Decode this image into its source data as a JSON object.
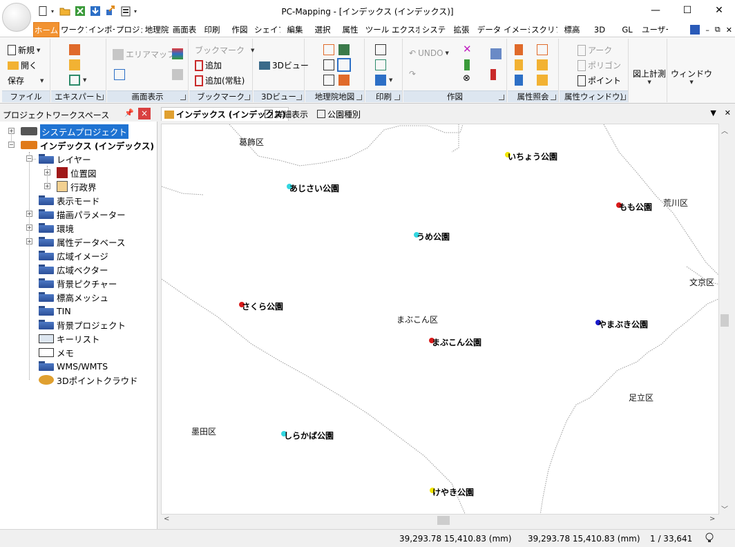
{
  "window": {
    "title": "PC-Mapping - [インデックス (インデックス)]",
    "controls": {
      "minimize": "—",
      "maximize": "☐",
      "close": "✕"
    }
  },
  "qat": {
    "items": [
      "new-doc-icon",
      "open-folder-icon",
      "excel-icon",
      "download-icon",
      "export-icon",
      "clipboard-icon"
    ]
  },
  "ribbon_tabs": [
    "ホーム",
    "ワークフ",
    "インポー",
    "プロジェ",
    "地理院",
    "画面表",
    "印刷",
    "作図",
    "シェイフ",
    "編集",
    "選択",
    "属性",
    "ツール",
    "エクスポ",
    "システ",
    "拡張",
    "データ",
    "イメージ",
    "スクリフ",
    "標高",
    "3D",
    "GL",
    "ユーザー"
  ],
  "ribbon_tab_controls": {
    "minimize": "–",
    "restore": "⧉",
    "close": "✕"
  },
  "ribbon": {
    "file": {
      "label": "ファイル",
      "new": "新規",
      "open": "開く",
      "save": "保存"
    },
    "expert": {
      "label": "エキスパート"
    },
    "view": {
      "label": "画面表示",
      "area_map": "エリアマップ"
    },
    "bookmark": {
      "label": "ブックマーク",
      "bookmark": "ブックマーク",
      "add": "追加",
      "add_resident": "追加(常駐)"
    },
    "view3d": {
      "label": "3Dビュー",
      "btn": "3Dビュー"
    },
    "gsi": {
      "label": "地理院地図"
    },
    "print": {
      "label": "印刷"
    },
    "draw": {
      "label": "作図",
      "undo": "UNDO"
    },
    "attr": {
      "label": "属性照会"
    },
    "attr_window": {
      "label": "属性ウィンドウ)",
      "arc": "アーク",
      "polygon": "ポリゴン",
      "point": "ポイント"
    },
    "measure": {
      "label": "図上計測"
    },
    "window": {
      "label": "ウィンドウ"
    }
  },
  "workspace": {
    "title": "プロジェクトワークスペース",
    "pin": "📌",
    "close": "×",
    "items": [
      {
        "label": "システムプロジェクト"
      },
      {
        "label": "インデックス (インデックス)"
      },
      {
        "label": "レイヤー"
      },
      {
        "label": "位置図"
      },
      {
        "label": "行政界"
      },
      {
        "label": "表示モード"
      },
      {
        "label": "描画パラメーター"
      },
      {
        "label": "環境"
      },
      {
        "label": "属性データベース"
      },
      {
        "label": "広域イメージ"
      },
      {
        "label": "広域ベクター"
      },
      {
        "label": "背景ピクチャー"
      },
      {
        "label": "標高メッシュ"
      },
      {
        "label": "TIN"
      },
      {
        "label": "背景プロジェクト"
      },
      {
        "label": "キーリスト"
      },
      {
        "label": "メモ"
      },
      {
        "label": "WMS/WMTS"
      },
      {
        "label": "3Dポイントクラウド"
      }
    ]
  },
  "doc_tabs": [
    {
      "label": "インデックス (インデックス)"
    },
    {
      "label": "詳細表示"
    },
    {
      "label": "公園種別"
    }
  ],
  "doc_controls": {
    "dropdown": "▼",
    "close": "✕"
  },
  "map": {
    "districts": [
      "葛飾区",
      "荒川区",
      "文京区",
      "まぶこん区",
      "足立区",
      "墨田区"
    ],
    "parks": [
      {
        "name": "いちょう公園",
        "color": "#f2e600"
      },
      {
        "name": "あじさい公園",
        "color": "#33d6e0"
      },
      {
        "name": "もも公園",
        "color": "#d91a1a"
      },
      {
        "name": "うめ公園",
        "color": "#33d6e0"
      },
      {
        "name": "さくら公園",
        "color": "#d91a1a"
      },
      {
        "name": "やまぶき公園",
        "color": "#1a1acc"
      },
      {
        "name": "まぶこん公園",
        "color": "#d91a1a"
      },
      {
        "name": "しらかば公園",
        "color": "#33d6e0"
      },
      {
        "name": "けやき公園",
        "color": "#f2e600"
      }
    ]
  },
  "status": {
    "coord1": "39,293.78 15,410.83 (mm)",
    "coord2": "39,293.78 15,410.83 (mm)",
    "scale": "1 / 33,641"
  }
}
